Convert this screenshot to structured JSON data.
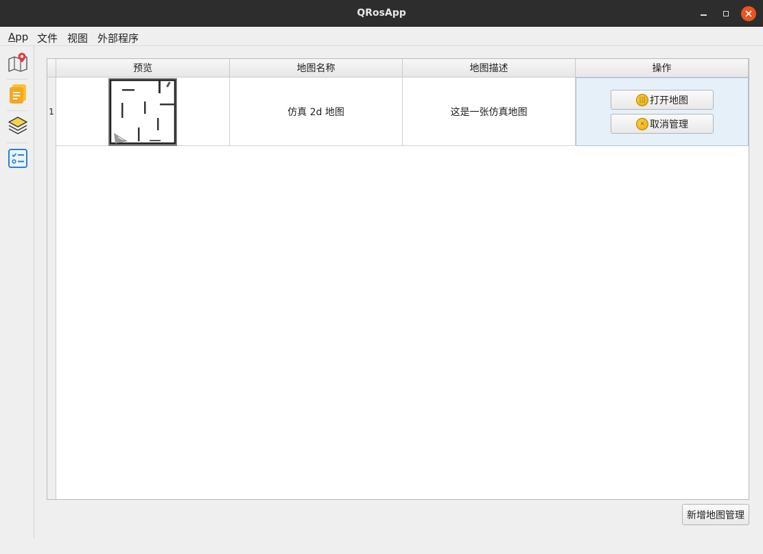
{
  "window": {
    "title": "QRosApp"
  },
  "menu": {
    "items": [
      "App",
      "文件",
      "视图",
      "外部程序"
    ]
  },
  "toolbar": {
    "icons": [
      "map-pin-icon",
      "notes-icon",
      "layers-icon",
      "checklist-icon"
    ]
  },
  "table": {
    "headers": [
      "预览",
      "地图名称",
      "地图描述",
      "操作"
    ],
    "rows": [
      {
        "index": "1",
        "name": "仿真 2d 地图",
        "description": "这是一张仿真地图",
        "actions": [
          "打开地图",
          "取消管理"
        ]
      }
    ]
  },
  "footer": {
    "add_button": "新增地图管理"
  },
  "colors": {
    "close_button": "#e9541f",
    "selected_cell": "#e6f0f8",
    "coin": "#f2b900"
  }
}
